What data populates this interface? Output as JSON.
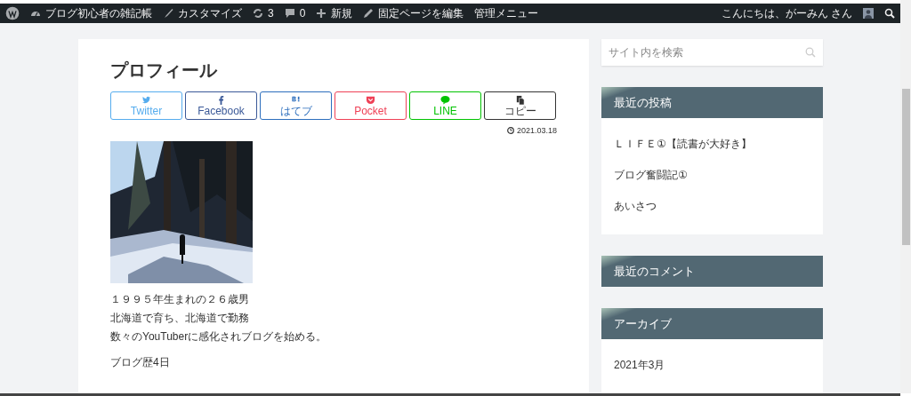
{
  "admin_bar": {
    "items": [
      {
        "kind": "wp"
      },
      {
        "kind": "dashboard",
        "label": "ブログ初心者の雑記帳"
      },
      {
        "kind": "brush",
        "label": "カスタマイズ"
      },
      {
        "kind": "updates",
        "label": "3"
      },
      {
        "kind": "comments",
        "label": "0"
      },
      {
        "kind": "plus",
        "label": "新規"
      },
      {
        "kind": "pencil",
        "label": "固定ページを編集"
      },
      {
        "kind": "none",
        "label": "管理メニュー"
      }
    ],
    "greeting": "こんにちは、がーみん さん"
  },
  "article": {
    "title": "プロフィール",
    "share_buttons": [
      {
        "kind": "twitter",
        "label": "Twitter",
        "color": "#55acee"
      },
      {
        "kind": "facebook",
        "label": "Facebook",
        "color": "#3b5998"
      },
      {
        "kind": "hatena",
        "label": "はてブ",
        "color": "#2c6ebd"
      },
      {
        "kind": "pocket",
        "label": "Pocket",
        "color": "#ef4056"
      },
      {
        "kind": "line",
        "label": "LINE",
        "color": "#00c300"
      },
      {
        "kind": "copy",
        "label": "コピー",
        "color": "#333333"
      }
    ],
    "date": "2021.03.18",
    "image": {
      "kind": "picture"
    },
    "paragraphs": [
      [
        "１９９５年生まれの２６歳男",
        "北海道で育ち、北海道で勤務",
        "数々のYouTuberに感化されブログを始める。"
      ],
      [
        "ブログ歴4日"
      ]
    ]
  },
  "sidebar": {
    "search": {
      "placeholder": "サイト内を検索"
    },
    "widgets": [
      {
        "title": "最近の投稿",
        "items": [
          "ＬＩＦＥ①【読書が大好き】",
          "ブログ奮闘記①",
          "あいさつ"
        ]
      },
      {
        "title": "最近のコメント"
      },
      {
        "title": "アーカイブ",
        "items": [
          "2021年3月"
        ]
      }
    ]
  }
}
